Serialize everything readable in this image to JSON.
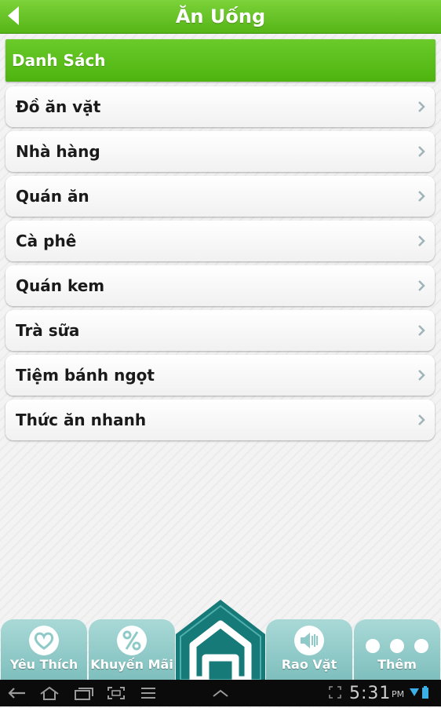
{
  "header": {
    "title": "Ăn Uống",
    "back_icon": "back-arrow-icon"
  },
  "section": {
    "title": "Danh Sách"
  },
  "categories": [
    {
      "label": "Đồ ăn vặt"
    },
    {
      "label": "Nhà hàng"
    },
    {
      "label": "Quán ăn"
    },
    {
      "label": "Cà phê"
    },
    {
      "label": "Quán kem"
    },
    {
      "label": "Trà sữa"
    },
    {
      "label": "Tiệm bánh ngọt"
    },
    {
      "label": "Thức ăn nhanh"
    }
  ],
  "tabs": [
    {
      "label": "Yêu Thích",
      "icon": "heart-icon"
    },
    {
      "label": "Khuyến Mãi",
      "icon": "percent-icon"
    },
    {
      "label": "",
      "icon": "home-icon"
    },
    {
      "label": "Rao Vặt",
      "icon": "speaker-icon"
    },
    {
      "label": "Thêm",
      "icon": "more-dots-icon"
    }
  ],
  "status": {
    "time": "5:31",
    "ampm": "PM"
  },
  "colors": {
    "header_green": "#56b517",
    "section_green": "#4eb30f",
    "tab_teal": "#7ebfbd",
    "home_teal": "#167a78",
    "navbar": "#0b0b0b"
  }
}
